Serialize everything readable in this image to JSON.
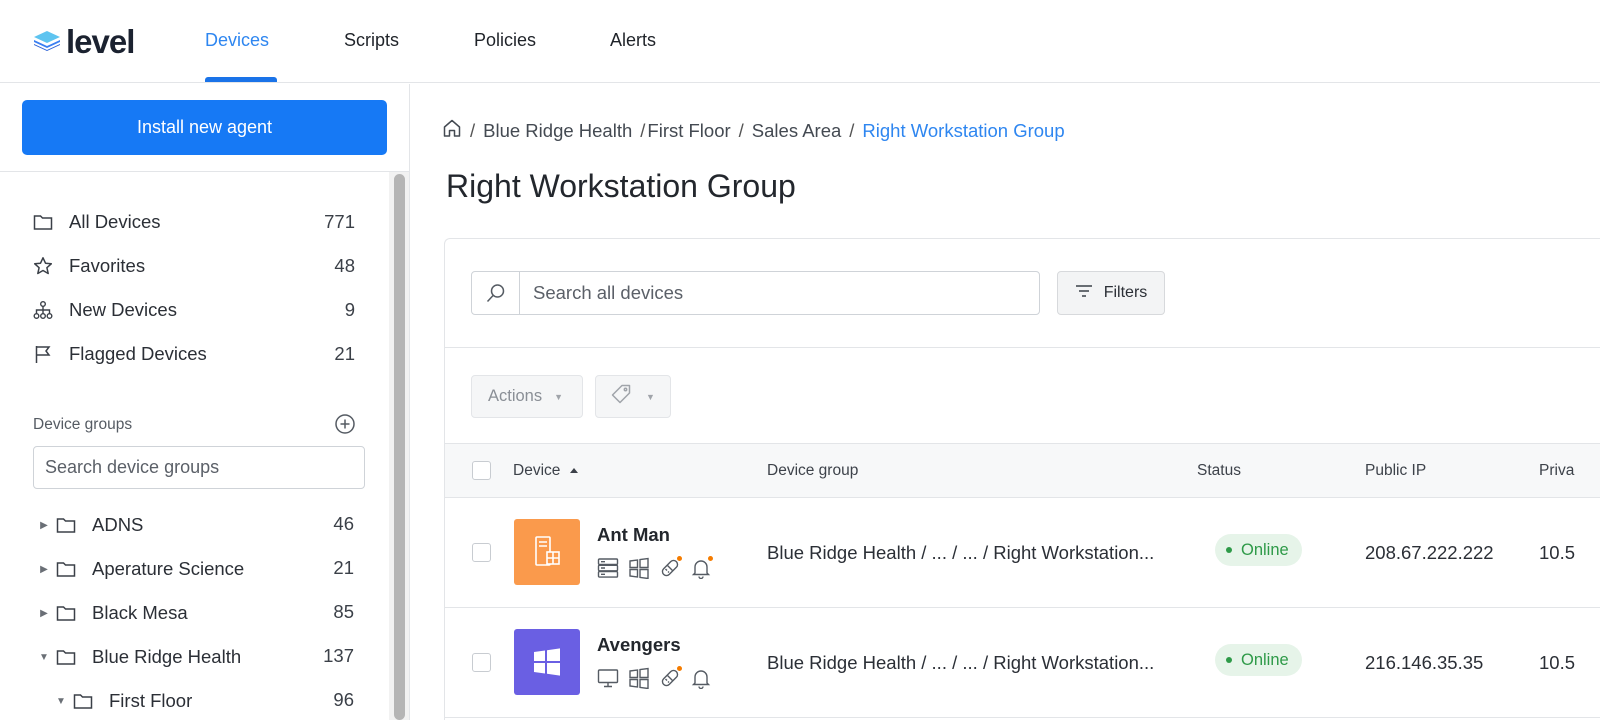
{
  "app": {
    "logo_text": "level"
  },
  "nav": {
    "tabs": [
      {
        "label": "Devices",
        "active": true
      },
      {
        "label": "Scripts",
        "active": false
      },
      {
        "label": "Policies",
        "active": false
      },
      {
        "label": "Alerts",
        "active": false
      }
    ]
  },
  "sidebar": {
    "install_label": "Install new agent",
    "items": [
      {
        "label": "All Devices",
        "count": "771",
        "icon": "folder-icon"
      },
      {
        "label": "Favorites",
        "count": "48",
        "icon": "star-icon"
      },
      {
        "label": "New Devices",
        "count": "9",
        "icon": "network-icon"
      },
      {
        "label": "Flagged Devices",
        "count": "21",
        "icon": "flag-icon"
      }
    ],
    "groups_label": "Device groups",
    "groups_search_placeholder": "Search device groups",
    "tree": [
      {
        "label": "ADNS",
        "count": "46",
        "expanded": false
      },
      {
        "label": "Aperature Science",
        "count": "21",
        "expanded": false
      },
      {
        "label": "Black Mesa",
        "count": "85",
        "expanded": false
      },
      {
        "label": "Blue Ridge Health",
        "count": "137",
        "expanded": true
      },
      {
        "label": "First Floor",
        "count": "96",
        "expanded": true
      }
    ]
  },
  "breadcrumb": {
    "items": [
      "Blue Ridge Health",
      "First Floor",
      "Sales Area"
    ],
    "current": "Right Workstation Group"
  },
  "page": {
    "title": "Right Workstation Group"
  },
  "toolbar": {
    "search_placeholder": "Search all devices",
    "filters_label": "Filters",
    "actions_label": "Actions"
  },
  "table": {
    "columns": [
      "Device",
      "Device group",
      "Status",
      "Public IP",
      "Priva"
    ],
    "rows": [
      {
        "name": "Ant Man",
        "group": "Blue Ridge Health / ... / ... / Right Workstation...",
        "status": "Online",
        "public_ip": "208.67.222.222",
        "private_ip": "10.5",
        "tile_color": "#fa9a4c",
        "tile_icon": "server-windows-icon"
      },
      {
        "name": "Avengers",
        "group": "Blue Ridge Health / ... / ... / Right Workstation...",
        "status": "Online",
        "public_ip": "216.146.35.35",
        "private_ip": "10.5",
        "tile_color": "#6a5fe3",
        "tile_icon": "windows-icon"
      }
    ]
  },
  "colors": {
    "accent": "#1679f5",
    "link": "#2e86f0",
    "online": "#2e9a48",
    "alert_dot": "#f57c00"
  }
}
